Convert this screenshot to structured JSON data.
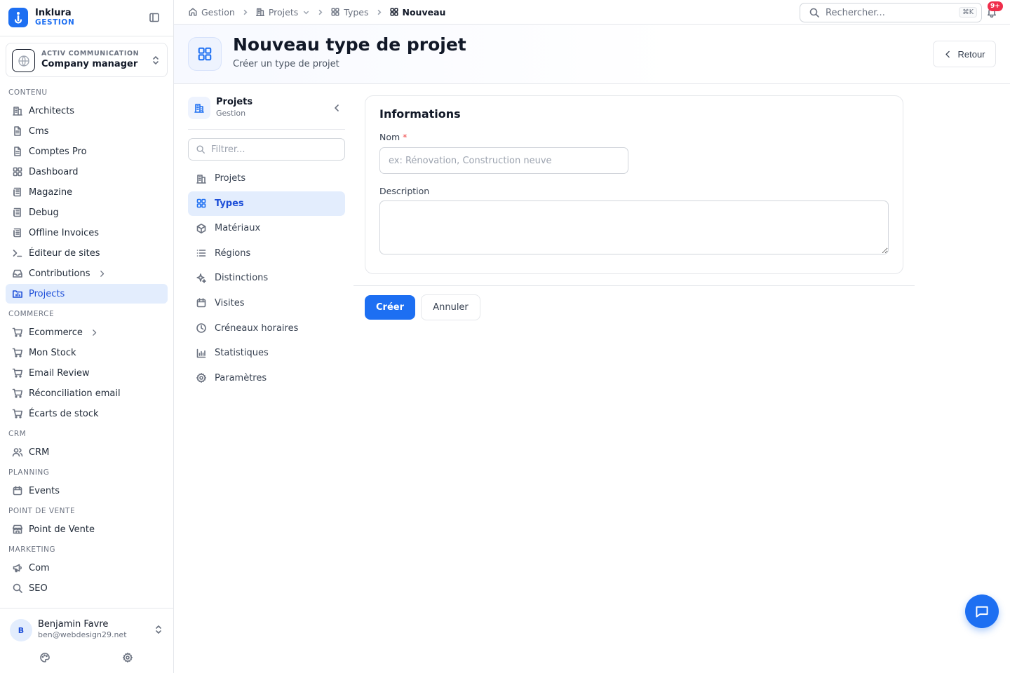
{
  "brand": {
    "name": "Inklura",
    "sub": "GESTION",
    "accent": "#1d6ff2"
  },
  "org": {
    "kicker": "ACTIV COMMUNICATION",
    "name": "Company manager"
  },
  "sidebar": {
    "sections": [
      {
        "label": "CONTENU",
        "items": [
          {
            "label": "Architects",
            "icon": "building-icon"
          },
          {
            "label": "Cms",
            "icon": "file-icon"
          },
          {
            "label": "Comptes Pro",
            "icon": "file-icon"
          },
          {
            "label": "Dashboard",
            "icon": "grid-icon"
          },
          {
            "label": "Magazine",
            "icon": "newspaper-icon"
          },
          {
            "label": "Debug",
            "icon": "newspaper-icon"
          },
          {
            "label": "Offline Invoices",
            "icon": "newspaper-icon"
          },
          {
            "label": "Éditeur de sites",
            "icon": "terminal-icon"
          },
          {
            "label": "Contributions",
            "icon": "inbox-icon",
            "has_children": true
          },
          {
            "label": "Projects",
            "icon": "folder-chart-icon",
            "active": true
          }
        ]
      },
      {
        "label": "COMMERCE",
        "items": [
          {
            "label": "Ecommerce",
            "icon": "cart-icon",
            "has_children": true
          },
          {
            "label": "Mon Stock",
            "icon": "cart-icon"
          },
          {
            "label": "Email Review",
            "icon": "cart-icon"
          },
          {
            "label": "Réconciliation email",
            "icon": "cart-icon"
          },
          {
            "label": "Écarts de stock",
            "icon": "cart-icon"
          }
        ]
      },
      {
        "label": "CRM",
        "items": [
          {
            "label": "CRM",
            "icon": "users-icon"
          }
        ]
      },
      {
        "label": "PLANNING",
        "items": [
          {
            "label": "Events",
            "icon": "calendar-icon"
          }
        ]
      },
      {
        "label": "POINT DE VENTE",
        "items": [
          {
            "label": "Point de Vente",
            "icon": "store-icon"
          }
        ]
      },
      {
        "label": "MARKETING",
        "items": [
          {
            "label": "Com",
            "icon": "megaphone-icon"
          },
          {
            "label": "SEO",
            "icon": "search-icon"
          }
        ]
      }
    ]
  },
  "user": {
    "initial": "B",
    "name": "Benjamin Favre",
    "email": "ben@webdesign29.net"
  },
  "breadcrumb": [
    {
      "label": "Gestion",
      "icon": "home-icon"
    },
    {
      "label": "Projets",
      "icon": "building-icon",
      "dropdown": true
    },
    {
      "label": "Types",
      "icon": "grid-icon"
    },
    {
      "label": "Nouveau",
      "icon": "grid-icon",
      "current": true
    }
  ],
  "search": {
    "placeholder": "Rechercher...",
    "shortcut": "⌘K"
  },
  "notifications": {
    "badge": "9+"
  },
  "header": {
    "title": "Nouveau type de projet",
    "subtitle": "Créer un type de projet",
    "back_label": "Retour"
  },
  "module": {
    "name": "Projets",
    "sub": "Gestion",
    "filter_placeholder": "Filtrer...",
    "items": [
      {
        "label": "Projets",
        "icon": "building-icon"
      },
      {
        "label": "Types",
        "icon": "grid-icon",
        "active": true
      },
      {
        "label": "Matériaux",
        "icon": "box-icon"
      },
      {
        "label": "Régions",
        "icon": "list-icon"
      },
      {
        "label": "Distinctions",
        "icon": "sparkles-icon"
      },
      {
        "label": "Visites",
        "icon": "calendar-icon"
      },
      {
        "label": "Créneaux horaires",
        "icon": "clock-icon"
      },
      {
        "label": "Statistiques",
        "icon": "bar-chart-icon"
      },
      {
        "label": "Paramètres",
        "icon": "gear-icon"
      }
    ]
  },
  "form": {
    "title": "Informations",
    "nom_label": "Nom",
    "nom_required": "*",
    "nom_placeholder": "ex: Rénovation, Construction neuve",
    "description_label": "Description",
    "create_label": "Créer",
    "cancel_label": "Annuler"
  }
}
